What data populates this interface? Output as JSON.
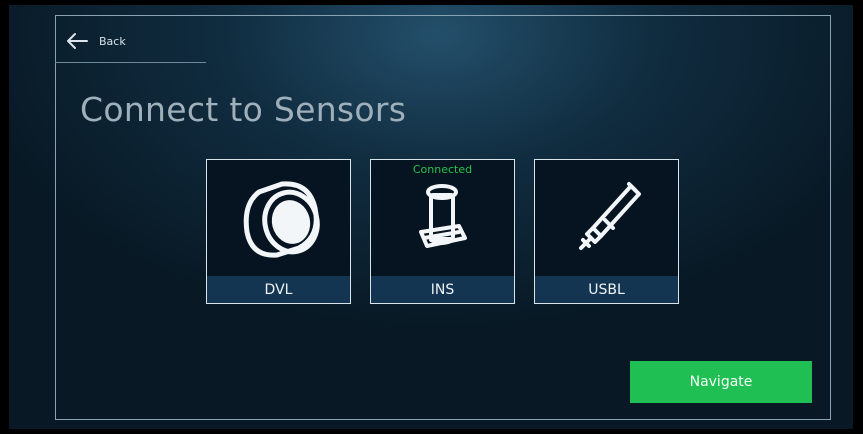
{
  "header": {
    "back_label": "Back",
    "back_icon": "arrow-left-icon"
  },
  "page": {
    "title": "Connect to Sensors"
  },
  "sensors": [
    {
      "label": "DVL",
      "icon": "dvl-sensor-icon",
      "status": ""
    },
    {
      "label": "INS",
      "icon": "ins-sensor-icon",
      "status": "Connected"
    },
    {
      "label": "USBL",
      "icon": "usbl-sensor-icon",
      "status": ""
    }
  ],
  "actions": {
    "navigate_label": "Navigate"
  },
  "colors": {
    "accent_green": "#1fbf53",
    "status_connected": "#27c24c",
    "tile_label_bar": "#143552"
  }
}
